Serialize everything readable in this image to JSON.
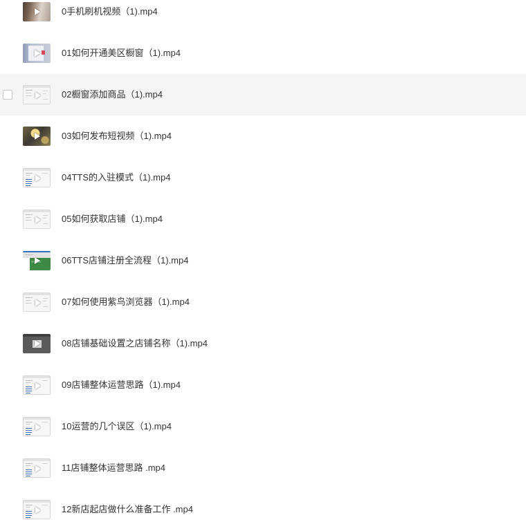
{
  "files": [
    {
      "name": "0手机刷机视频（1).mp4"
    },
    {
      "name": "01如何开通美区橱窗（1).mp4"
    },
    {
      "name": "02橱窗添加商品（1).mp4"
    },
    {
      "name": "03如何发布短视频（1).mp4"
    },
    {
      "name": "04TTS的入驻模式（1).mp4"
    },
    {
      "name": "05如何获取店铺（1).mp4"
    },
    {
      "name": "06TTS店铺注册全流程（1).mp4"
    },
    {
      "name": "07如何使用紫鸟浏览器（1).mp4"
    },
    {
      "name": "08店铺基础设置之店铺名称（1).mp4"
    },
    {
      "name": "09店铺整体运营思路（1).mp4"
    },
    {
      "name": "10运营的几个误区（1).mp4"
    },
    {
      "name": "11店铺整体运营思路 .mp4"
    },
    {
      "name": "12新店起店做什么准备工作 .mp4"
    }
  ]
}
